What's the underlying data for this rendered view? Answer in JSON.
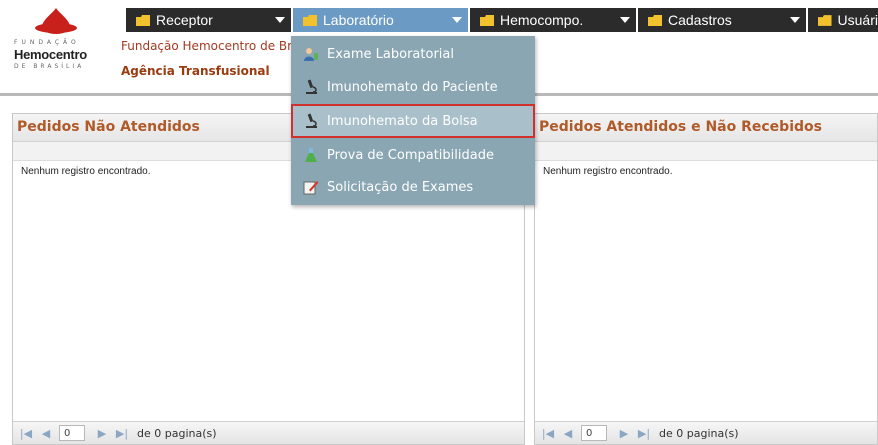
{
  "logo": {
    "top_text": "FUNDAÇÃO",
    "brand": "Hemocentro",
    "bottom_text": "DE BRASÍLIA"
  },
  "header": {
    "line1": "Fundação Hemocentro de Brasília",
    "line2": "Agência Transfusional"
  },
  "top_menu": [
    {
      "label": "Receptor",
      "active": false
    },
    {
      "label": "Laboratório",
      "active": true
    },
    {
      "label": "Hemocompo.",
      "active": false
    },
    {
      "label": "Cadastros",
      "active": false
    },
    {
      "label": "Usuári",
      "active": false
    }
  ],
  "dropdown": {
    "items": [
      {
        "label": "Exame Laboratorial",
        "icon": "user-lab-icon"
      },
      {
        "label": "Imunohemato do Paciente",
        "icon": "microscope-icon"
      },
      {
        "label": "Imunohemato da Bolsa",
        "icon": "microscope-icon",
        "highlighted": true
      },
      {
        "label": "Prova de Compatibilidade",
        "icon": "flask-icon"
      },
      {
        "label": "Solicitação de Exames",
        "icon": "form-pencil-icon"
      }
    ]
  },
  "panels": {
    "left": {
      "title": "Pedidos Não Atendidos",
      "empty_text": "Nenhum registro encontrado.",
      "pager": {
        "page_value": "0",
        "pages_text": "de 0 pagina(s)"
      }
    },
    "right": {
      "title": "Pedidos Atendidos e Não Recebidos",
      "empty_text": "Nenhum registro encontrado.",
      "pager": {
        "page_value": "0",
        "pages_text": "de 0 pagina(s)"
      }
    }
  },
  "colors": {
    "menu_bg": "#2b2b2b",
    "menu_active": "#6b9ac5",
    "dropdown_bg": "#8aa6b3",
    "highlight_border": "#d0312d",
    "title_text": "#b05a2a"
  }
}
